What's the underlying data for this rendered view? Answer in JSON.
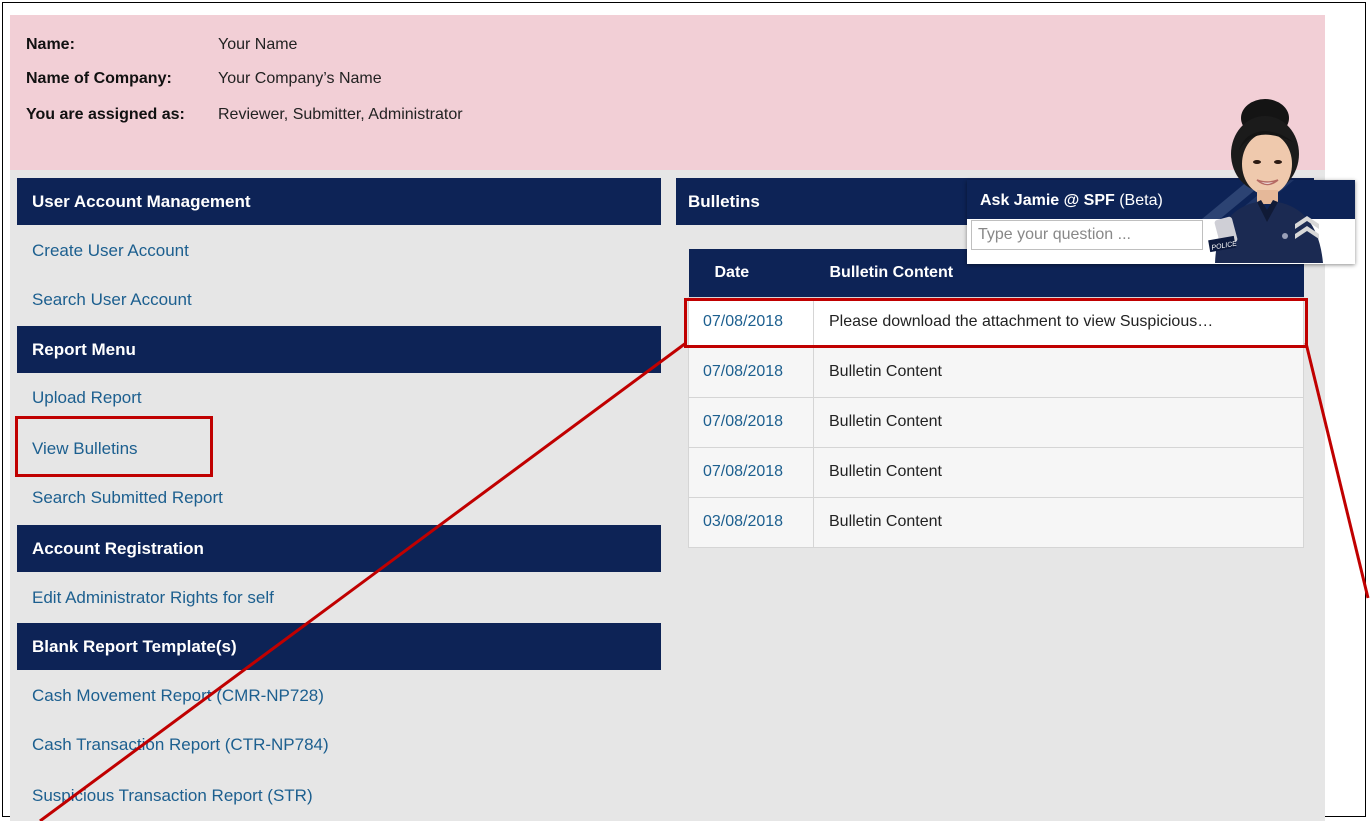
{
  "user_info": {
    "name_label": "Name:",
    "name_value": "Your Name",
    "company_label": "Name of Company:",
    "company_value": "Your Company’s Name",
    "assigned_label": "You are assigned as:",
    "assigned_value": "Reviewer, Submitter, Administrator"
  },
  "sections": {
    "user_account": {
      "title": "User Account Management",
      "links": [
        "Create User Account",
        "Search User Account"
      ]
    },
    "report_menu": {
      "title": "Report Menu",
      "links": [
        "Upload Report",
        "View Bulletins",
        "Search Submitted Report"
      ]
    },
    "account_registration": {
      "title": "Account Registration",
      "links": [
        "Edit Administrator Rights for self"
      ]
    },
    "templates": {
      "title": "Blank Report Template(s)",
      "links": [
        "Cash Movement Report (CMR-NP728)",
        "Cash Transaction Report (CTR-NP784)",
        "Suspicious Transaction Report (STR)"
      ]
    }
  },
  "bulletins": {
    "title": "Bulletins",
    "columns": [
      "Date",
      "Bulletin Content"
    ],
    "rows": [
      {
        "date": "07/08/2018",
        "content": "Please download the attachment to view Suspicious…"
      },
      {
        "date": "07/08/2018",
        "content": "Bulletin Content"
      },
      {
        "date": "07/08/2018",
        "content": "Bulletin Content"
      },
      {
        "date": "07/08/2018",
        "content": "Bulletin Content"
      },
      {
        "date": "03/08/2018",
        "content": "Bulletin Content"
      }
    ]
  },
  "chat": {
    "title_main": "Ask Jamie @ SPF",
    "title_suffix": " (Beta)",
    "placeholder": "Type your question ...",
    "badge_text": "POLICE"
  },
  "colors": {
    "navy": "#0d2356",
    "info_bg": "#f2cfd6",
    "panel_bg": "#e6e6e6",
    "link": "#1c5f8f",
    "highlight": "#c00000"
  }
}
